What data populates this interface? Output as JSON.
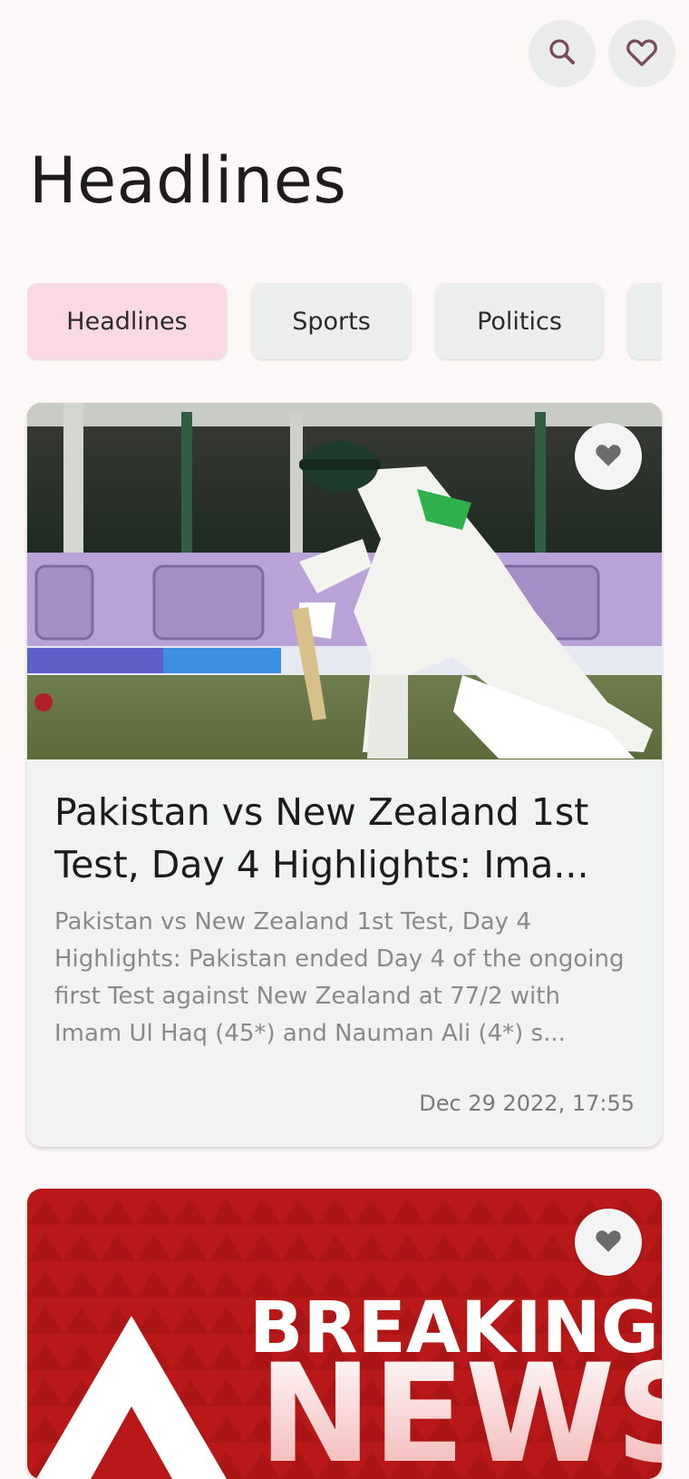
{
  "header": {
    "search_icon": "search-icon",
    "favorites_icon": "heart-outline-icon"
  },
  "page": {
    "title": "Headlines"
  },
  "tabs": [
    {
      "label": "Headlines",
      "active": true
    },
    {
      "label": "Sports",
      "active": false
    },
    {
      "label": "Politics",
      "active": false
    },
    {
      "label": "",
      "active": false
    }
  ],
  "articles": [
    {
      "image": "cricket-batsman-photo",
      "favorite_icon": "heart-filled-icon",
      "title": "Pakistan vs New Zealand 1st Test, Day 4 Highlights: Ima...",
      "description": "Pakistan vs New Zealand 1st Test, Day 4 Highlights: Pakistan ended Day 4 of the ongoing first Test against New Zealand at 77/2 with Imam Ul Haq (45*) and Nauman Ali (4*) s...",
      "date": "Dec 29 2022, 17:55"
    },
    {
      "image": "breaking-news-graphic",
      "favorite_icon": "heart-filled-icon",
      "image_text_1": "BREAKING",
      "image_text_2": "NEWS"
    }
  ],
  "colors": {
    "background": "#fdf8f8",
    "active_tab": "#fbd9e4",
    "inactive_tab": "#eceeed",
    "card": "#f1f2f2",
    "icon": "#7a4b5b",
    "breaking_red": "#b81818"
  }
}
